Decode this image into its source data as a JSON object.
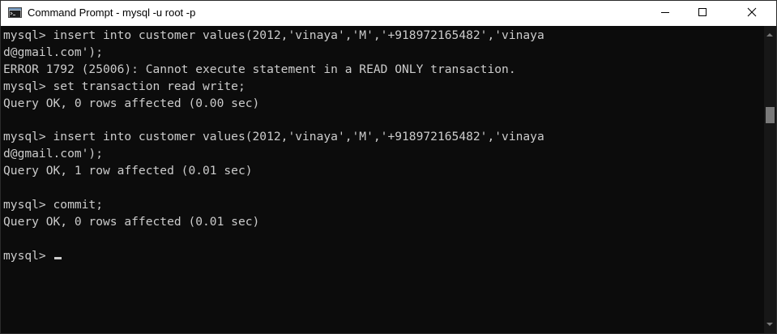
{
  "window": {
    "title": "Command Prompt - mysql -u root -p",
    "icon": "cmd-console-icon",
    "controls": {
      "minimize_icon": "minimize-icon",
      "maximize_icon": "maximize-icon",
      "close_icon": "close-icon"
    }
  },
  "console": {
    "lines": [
      "mysql> insert into customer values(2012,'vinaya','M','+918972165482','vinaya",
      "d@gmail.com');",
      "ERROR 1792 (25006): Cannot execute statement in a READ ONLY transaction.",
      "mysql> set transaction read write;",
      "Query OK, 0 rows affected (0.00 sec)",
      "",
      "mysql> insert into customer values(2012,'vinaya','M','+918972165482','vinaya",
      "d@gmail.com');",
      "Query OK, 1 row affected (0.01 sec)",
      "",
      "mysql> commit;",
      "Query OK, 0 rows affected (0.01 sec)",
      ""
    ],
    "prompt": "mysql> "
  },
  "colors": {
    "console_bg": "#0c0c0c",
    "console_text": "#cccccc",
    "titlebar_bg": "#ffffff"
  }
}
